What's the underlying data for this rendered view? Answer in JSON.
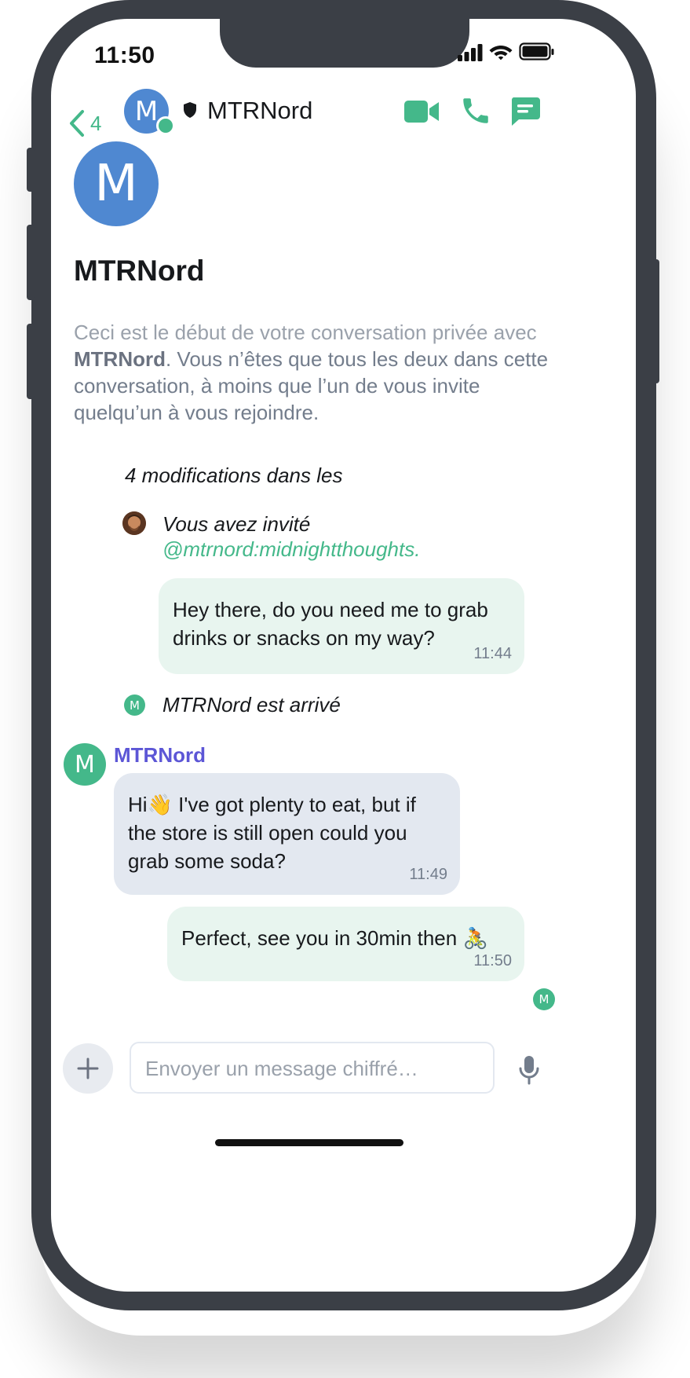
{
  "status_bar": {
    "time": "11:50"
  },
  "header": {
    "back_count": "4",
    "avatar_letter": "M",
    "title": "MTRNord"
  },
  "room_intro": {
    "avatar_letter": "M",
    "title": "MTRNord",
    "desc_part1": "Ceci est le début de votre conversation privée avec ",
    "desc_bold": "MTRNord",
    "desc_part2": ". Vous n’êtes que tous les deux dans cette conversation, à moins que l’un de vous invite quelqu’un à vous rejoindre."
  },
  "timeline": {
    "summary": "4 modifications dans les",
    "invite_text": "Vous avez invité",
    "invite_user": "@mtrnord:midnightthoughts.",
    "msg1": {
      "text": "Hey there, do you need me to grab drinks or snacks on my way?",
      "time": "11:44"
    },
    "join_avatar": "M",
    "join_text": "MTRNord est arrivé",
    "sender_avatar": "M",
    "sender_name": "MTRNord",
    "msg2": {
      "text_a": "Hi",
      "emoji_a": "👋",
      "text_b": " I've got plenty to eat, but if the store is still open could you grab some soda?",
      "time": "11:49"
    },
    "msg3": {
      "text": "Perfect, see you in 30min then ",
      "emoji": "🚴",
      "time": "11:50"
    },
    "read_receipt": "M"
  },
  "composer": {
    "placeholder": "Envoyer un message chiffré…"
  },
  "colors": {
    "accent": "#44b88a",
    "avatar_blue": "#4f88d1",
    "sender_purple": "#5c56d6",
    "frame": "#3b3f46"
  }
}
